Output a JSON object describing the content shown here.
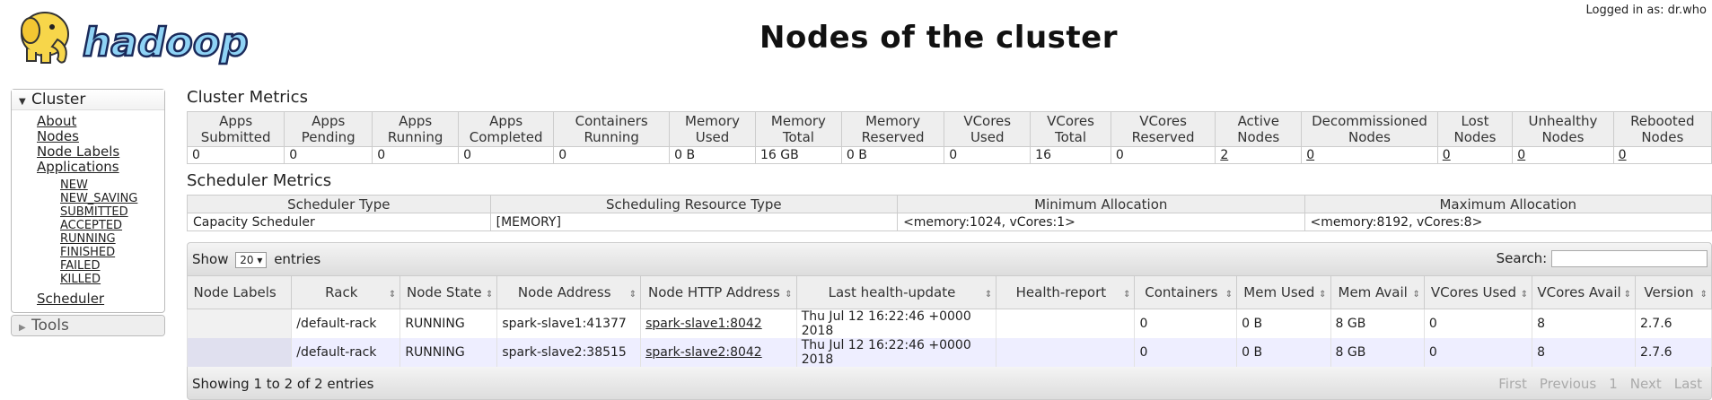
{
  "app": {
    "logo_text": "hadoop",
    "title": "Nodes of the cluster",
    "login": "Logged in as: dr.who"
  },
  "sidebar": {
    "cluster_label": "Cluster",
    "links": [
      "About",
      "Nodes",
      "Node Labels",
      "Applications"
    ],
    "app_states": [
      "NEW",
      "NEW_SAVING",
      "SUBMITTED",
      "ACCEPTED",
      "RUNNING",
      "FINISHED",
      "FAILED",
      "KILLED"
    ],
    "scheduler": "Scheduler",
    "tools_label": "Tools"
  },
  "cluster_metrics": {
    "title": "Cluster Metrics",
    "headers": [
      "Apps Submitted",
      "Apps Pending",
      "Apps Running",
      "Apps Completed",
      "Containers Running",
      "Memory Used",
      "Memory Total",
      "Memory Reserved",
      "VCores Used",
      "VCores Total",
      "VCores Reserved",
      "Active Nodes",
      "Decommissioned Nodes",
      "Lost Nodes",
      "Unhealthy Nodes",
      "Rebooted Nodes"
    ],
    "values": [
      "0",
      "0",
      "0",
      "0",
      "0",
      "0 B",
      "16 GB",
      "0 B",
      "0",
      "16",
      "0",
      "2",
      "0",
      "0",
      "0",
      "0"
    ]
  },
  "scheduler_metrics": {
    "title": "Scheduler Metrics",
    "headers": [
      "Scheduler Type",
      "Scheduling Resource Type",
      "Minimum Allocation",
      "Maximum Allocation"
    ],
    "values": [
      "Capacity Scheduler",
      "[MEMORY]",
      "<memory:1024, vCores:1>",
      "<memory:8192, vCores:8>"
    ]
  },
  "nodes_table": {
    "show_label": "Show",
    "entries_label": "entries",
    "page_size": "20",
    "search_label": "Search:",
    "search_value": "",
    "headers": [
      "Node Labels",
      "Rack",
      "Node State",
      "Node Address",
      "Node HTTP Address",
      "Last health-update",
      "Health-report",
      "Containers",
      "Mem Used",
      "Mem Avail",
      "VCores Used",
      "VCores Avail",
      "Version"
    ],
    "rows": [
      [
        "",
        "/default-rack",
        "RUNNING",
        "spark-slave1:41377",
        "spark-slave1:8042",
        "Thu Jul 12 16:22:46 +0000 2018",
        "",
        "0",
        "0 B",
        "8 GB",
        "0",
        "8",
        "2.7.6"
      ],
      [
        "",
        "/default-rack",
        "RUNNING",
        "spark-slave2:38515",
        "spark-slave2:8042",
        "Thu Jul 12 16:22:46 +0000 2018",
        "",
        "0",
        "0 B",
        "8 GB",
        "0",
        "8",
        "2.7.6"
      ]
    ],
    "info": "Showing 1 to 2 of 2 entries",
    "pager": [
      "First",
      "Previous",
      "1",
      "Next",
      "Last"
    ]
  }
}
